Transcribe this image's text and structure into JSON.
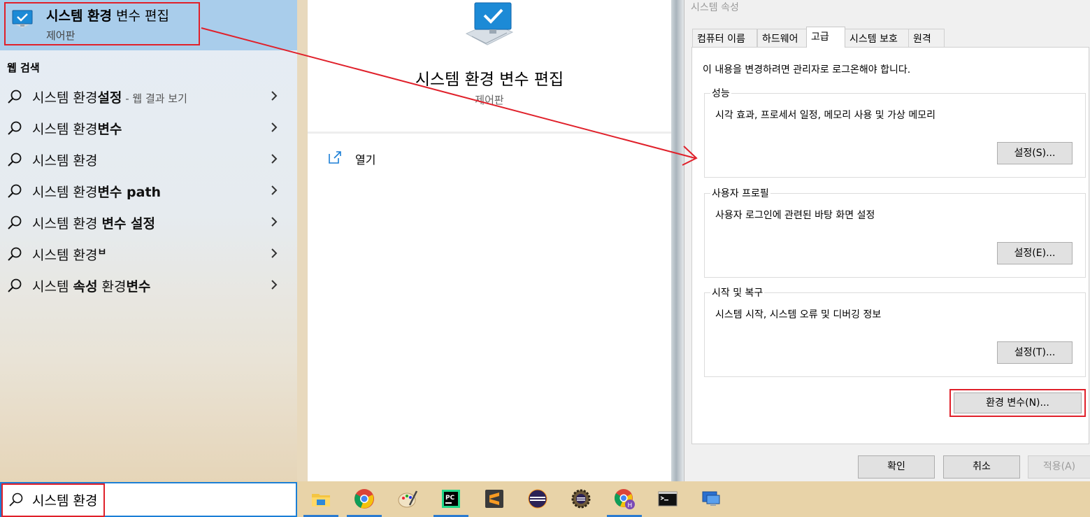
{
  "start_menu": {
    "best_match": {
      "title_bold": "시스템 환경",
      "title_rest": " 변수 편집",
      "subtitle": "제어판",
      "icon": "monitor-check-icon"
    },
    "web_section_header": "웹 검색",
    "suggestions": [
      {
        "prefix": "시스템 환경",
        "bold": "설정",
        "suffix": " - 웹 결과 보기"
      },
      {
        "prefix": "시스템 환경",
        "bold": "변수",
        "suffix": ""
      },
      {
        "prefix": "시스템 환경",
        "bold": "",
        "suffix": ""
      },
      {
        "prefix": "시스템 환경",
        "bold": "변수 path",
        "suffix": ""
      },
      {
        "prefix": "시스템 환경 ",
        "bold": "변수 설정",
        "suffix": ""
      },
      {
        "prefix": "시스템 환경",
        "bold": "ㅂ",
        "suffix": ""
      },
      {
        "prefix": "시스템 ",
        "bold": "속성",
        "mid": " 환경",
        "bold2": "변수"
      }
    ],
    "preview": {
      "title": "시스템 환경 변수 편집",
      "subtitle": "제어판",
      "open_label": "열기"
    }
  },
  "dialog": {
    "title": "시스템 속성",
    "tabs": [
      "컴퓨터 이름",
      "하드웨어",
      "고급",
      "시스템 보호",
      "원격"
    ],
    "active_tab": "고급",
    "admin_note": "이 내용을 변경하려면 관리자로 로그온해야 합니다.",
    "groups": [
      {
        "title": "성능",
        "desc": "시각 효과, 프로세서 일정, 메모리 사용 및 가상 메모리",
        "button": "설정(S)..."
      },
      {
        "title": "사용자 프로필",
        "desc": "사용자 로그인에 관련된 바탕 화면 설정",
        "button": "설정(E)..."
      },
      {
        "title": "시작 및 복구",
        "desc": "시스템 시작, 시스템 오류 및 디버깅 정보",
        "button": "설정(T)..."
      }
    ],
    "env_button": "환경 변수(N)...",
    "ok": "확인",
    "cancel": "취소",
    "apply": "적용(A)"
  },
  "taskbar": {
    "search_value": "시스템 환경",
    "apps": [
      {
        "name": "file-explorer-icon",
        "running": true
      },
      {
        "name": "chrome-icon",
        "running": true
      },
      {
        "name": "paint-icon",
        "running": false
      },
      {
        "name": "pycharm-icon",
        "running": true
      },
      {
        "name": "sublime-text-icon",
        "running": false
      },
      {
        "name": "eclipse-icon",
        "running": false
      },
      {
        "name": "eclipse-gear-icon",
        "running": false
      },
      {
        "name": "chrome-profile-icon",
        "running": true
      },
      {
        "name": "terminal-icon",
        "running": false
      },
      {
        "name": "remote-desktop-icon",
        "running": false
      }
    ]
  },
  "colors": {
    "highlight_red": "#e0202a",
    "selection_blue": "#a9cdeb",
    "search_border": "#1b7fd6",
    "taskbar_bg": "#e8d3a8"
  }
}
